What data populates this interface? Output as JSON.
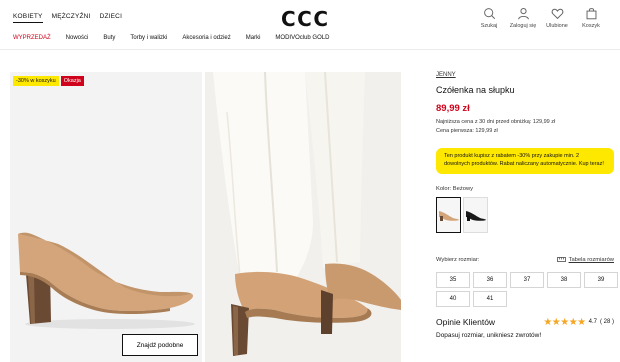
{
  "header": {
    "logo": "CCC",
    "gender_tabs": [
      "KOBIETY",
      "MĘŻCZYŹNI",
      "DZIECI"
    ],
    "user_links": {
      "search": "Szukaj",
      "login": "Zaloguj się",
      "favorites": "Ulubione",
      "cart": "Koszyk"
    },
    "nav": [
      "WYPRZEDAŻ",
      "Nowości",
      "Buty",
      "Torby i walizki",
      "Akcesoria i odzież",
      "Marki",
      "MODIVOclub GOLD"
    ]
  },
  "gallery": {
    "badge_discount": "-30% w koszyku",
    "badge_deal": "Okazja",
    "similar_button": "Znajdź podobne"
  },
  "product": {
    "brand": "JENNY",
    "name": "Czółenka na słupku",
    "price": "89,99 zł",
    "lowest_price": "Najniższa cena z 30 dni przed obniżką: 129,99 zł",
    "first_price": "Cena pierwsza: 129,99 zł",
    "promo": "Ten produkt kupisz z rabatem -30% przy zakupie min. 2 dowolnych produktów. Rabat naliczany automatycznie. Kup teraz!",
    "color_label": "Kolor: Beżowy",
    "size_label": "Wybierz rozmiar:",
    "size_table": "Tabela rozmiarów",
    "sizes": [
      "35",
      "36",
      "37",
      "38",
      "39",
      "40",
      "41"
    ],
    "reviews_title": "Opinie Klientów",
    "rating": "4.7",
    "rating_count": "( 28 )",
    "review_sub": "Dopasuj rozmiar, unikniesz zwrotów!"
  },
  "colors": {
    "accent_red": "#d0021b",
    "promo_yellow": "#ffe800"
  }
}
